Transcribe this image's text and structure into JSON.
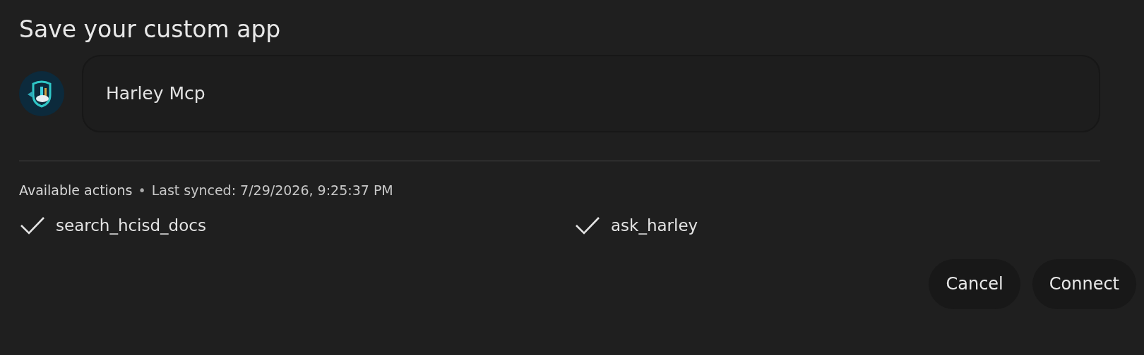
{
  "dialog": {
    "title": "Save your custom app"
  },
  "app": {
    "name_field": {
      "value": "Harley Mcp"
    }
  },
  "actions_header": {
    "label": "Available actions",
    "separator": "•",
    "synced": "Last synced: 7/29/2026, 9:25:37 PM"
  },
  "actions": [
    {
      "name": "search_hcisd_docs",
      "checked": true
    },
    {
      "name": "ask_harley",
      "checked": true
    }
  ],
  "buttons": [
    {
      "label": "Cancel"
    },
    {
      "label": "Connect"
    }
  ]
}
